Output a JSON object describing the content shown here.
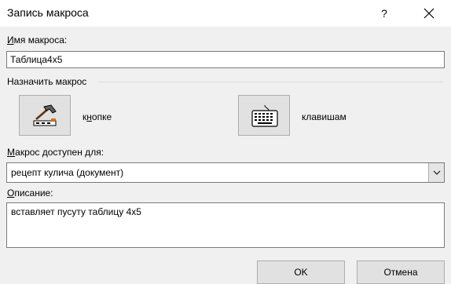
{
  "dialog": {
    "title": "Запись макроса",
    "help_label": "?",
    "macro_name": {
      "label_accel": "И",
      "label_rest": "мя макроса:",
      "value": "Таблица4х5"
    },
    "assign": {
      "label": "Назначить макрос",
      "button_label_accel": "н",
      "button_label_start": "к",
      "button_label_rest": "опке",
      "keyboard_label": "клавишам",
      "button_icon": "hammer-icon",
      "keyboard_icon": "keyboard-icon"
    },
    "store_in": {
      "label_accel": "М",
      "label_rest": "акрос доступен для:",
      "selected": "рецепт кулича (документ)"
    },
    "description": {
      "label_accel": "О",
      "label_rest": "писание:",
      "value": "вставляет пусуту таблицу 4х5"
    },
    "buttons": {
      "ok": "OK",
      "cancel": "Отмена"
    },
    "colors": {
      "background": "#f0f0f0",
      "titlebar": "#ffffff",
      "button_face": "#e1e1e1",
      "border": "#adadad"
    }
  }
}
